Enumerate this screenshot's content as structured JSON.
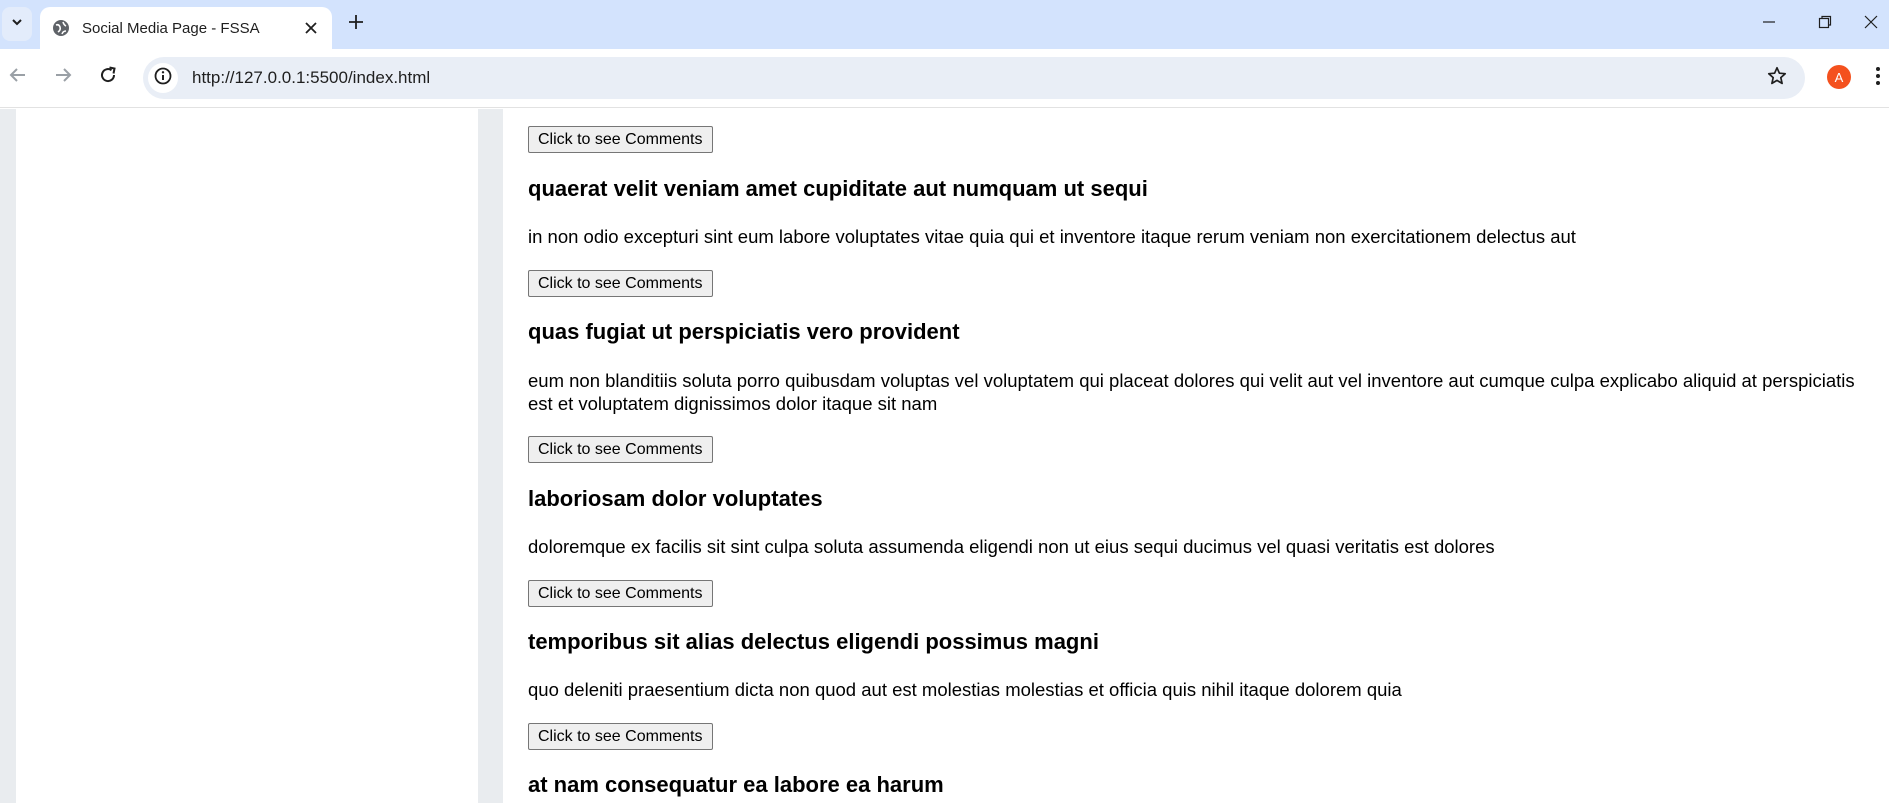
{
  "browser": {
    "tab_title": "Social Media Page - FSSA",
    "url": "http://127.0.0.1:5500/index.html",
    "profile_initial": "A"
  },
  "feed": {
    "posts": [
      {
        "button_label": "Click to see Comments"
      },
      {
        "title": "quaerat velit veniam amet cupiditate aut numquam ut sequi",
        "body": "in non odio excepturi sint eum labore voluptates vitae quia qui et inventore itaque rerum veniam non exercitationem delectus aut",
        "button_label": "Click to see Comments"
      },
      {
        "title": "quas fugiat ut perspiciatis vero provident",
        "body": "eum non blanditiis soluta porro quibusdam voluptas vel voluptatem qui placeat dolores qui velit aut vel inventore aut cumque culpa explicabo aliquid at perspiciatis est et voluptatem dignissimos dolor itaque sit nam",
        "button_label": "Click to see Comments"
      },
      {
        "title": "laboriosam dolor voluptates",
        "body": "doloremque ex facilis sit sint culpa soluta assumenda eligendi non ut eius sequi ducimus vel quasi veritatis est dolores",
        "button_label": "Click to see Comments"
      },
      {
        "title": "temporibus sit alias delectus eligendi possimus magni",
        "body": "quo deleniti praesentium dicta non quod aut est molestias molestias et officia quis nihil itaque dolorem quia",
        "button_label": "Click to see Comments"
      },
      {
        "title": "at nam consequatur ea labore ea harum"
      }
    ]
  }
}
